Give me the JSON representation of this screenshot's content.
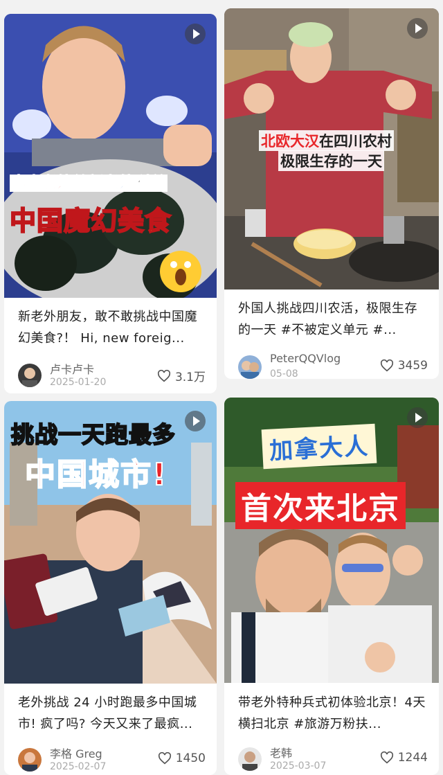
{
  "feed": {
    "cards": [
      {
        "overlay_line1_a": "本土老外",
        "overlay_line1_b": "给",
        "overlay_line1_c": "新老外",
        "overlay_line1_d": "科普",
        "overlay_line2": "中国魔幻美食",
        "title": "新老外朋友，敢不敢挑战中国魔幻美食?！ Hi, new foreig...",
        "author": "卢卡卢卡",
        "date": "2025-01-20",
        "likes": "3.1万"
      },
      {
        "overlay_line1_a": "北欧大汉",
        "overlay_line1_b": "在四川农村",
        "overlay_line2": "极限生存的一天",
        "title": "外国人挑战四川农活，极限生存的一天 #不被定义单元 #...",
        "author": "PeterQQVlog",
        "date": "05-08",
        "likes": "3459"
      },
      {
        "overlay_line1": "挑战一天跑最多",
        "overlay_line2": "中国城市!",
        "title": "老外挑战 24 小时跑最多中国城市! 疯了吗? 今天又来了最疯...",
        "author": "李格 Greg",
        "date": "2025-02-07",
        "likes": "1450"
      },
      {
        "overlay_line1": "加拿大人",
        "overlay_line2": "首次来北京",
        "title": "带老外特种兵式初体验北京！4天横扫北京 #旅游万粉扶...",
        "author": "老韩",
        "date": "2025-03-07",
        "likes": "1244"
      }
    ]
  },
  "colors": {
    "background": "#f2f2f2",
    "card": "#ffffff",
    "overlay_red": "#e8262a",
    "overlay_yellow": "#ffe033",
    "overlay_blue": "#2a6fd6"
  }
}
